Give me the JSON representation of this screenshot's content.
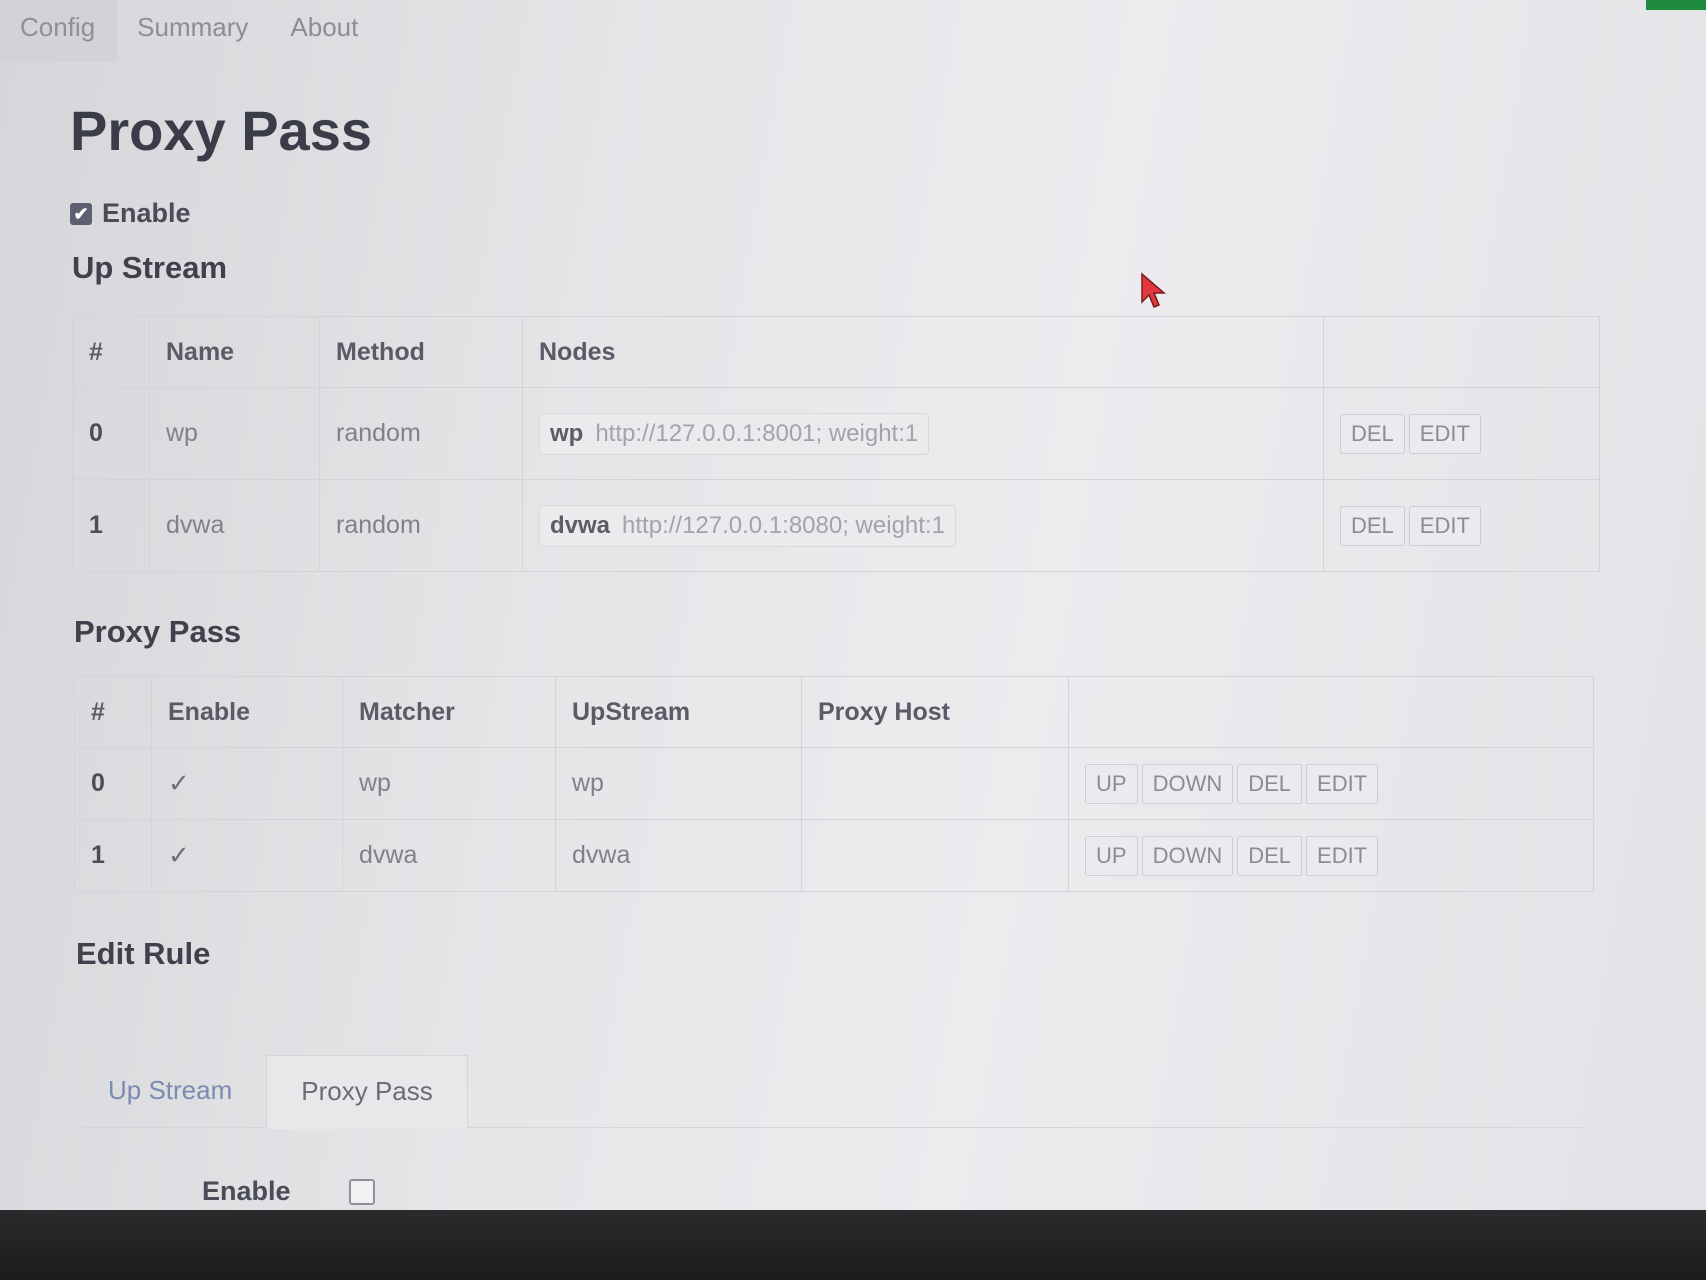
{
  "nav": {
    "tabs": [
      "Config",
      "Summary",
      "About"
    ],
    "active": "Config"
  },
  "page": {
    "title": "Proxy Pass",
    "enable_label": "Enable",
    "enable_checked": true
  },
  "upstream": {
    "title": "Up Stream",
    "columns": [
      "#",
      "Name",
      "Method",
      "Nodes",
      ""
    ],
    "rows": [
      {
        "idx": "0",
        "name": "wp",
        "method": "random",
        "node_name": "wp",
        "node_detail": "http://127.0.0.1:8001; weight:1",
        "del": "DEL",
        "edit": "EDIT"
      },
      {
        "idx": "1",
        "name": "dvwa",
        "method": "random",
        "node_name": "dvwa",
        "node_detail": "http://127.0.0.1:8080; weight:1",
        "del": "DEL",
        "edit": "EDIT"
      }
    ]
  },
  "proxypass": {
    "title": "Proxy Pass",
    "columns": [
      "#",
      "Enable",
      "Matcher",
      "UpStream",
      "Proxy Host",
      ""
    ],
    "rows": [
      {
        "idx": "0",
        "enabled": "✓",
        "matcher": "wp",
        "upstream": "wp",
        "proxy_host": "",
        "up": "UP",
        "down": "DOWN",
        "del": "DEL",
        "edit": "EDIT"
      },
      {
        "idx": "1",
        "enabled": "✓",
        "matcher": "dvwa",
        "upstream": "dvwa",
        "proxy_host": "",
        "up": "UP",
        "down": "DOWN",
        "del": "DEL",
        "edit": "EDIT"
      }
    ]
  },
  "edit_rule": {
    "title": "Edit Rule",
    "tabs": [
      "Up Stream",
      "Proxy Pass"
    ],
    "active_tab": "Proxy Pass",
    "enable_label": "Enable",
    "enable_checked": false
  },
  "icons": {
    "cursor": "mouse-pointer-icon",
    "checkbox": "checkbox-icon",
    "check": "check-mark-icon"
  },
  "colors": {
    "cursor": "#e2383c",
    "title": "#3a3c48",
    "link_tab": "#7a8bb0"
  }
}
